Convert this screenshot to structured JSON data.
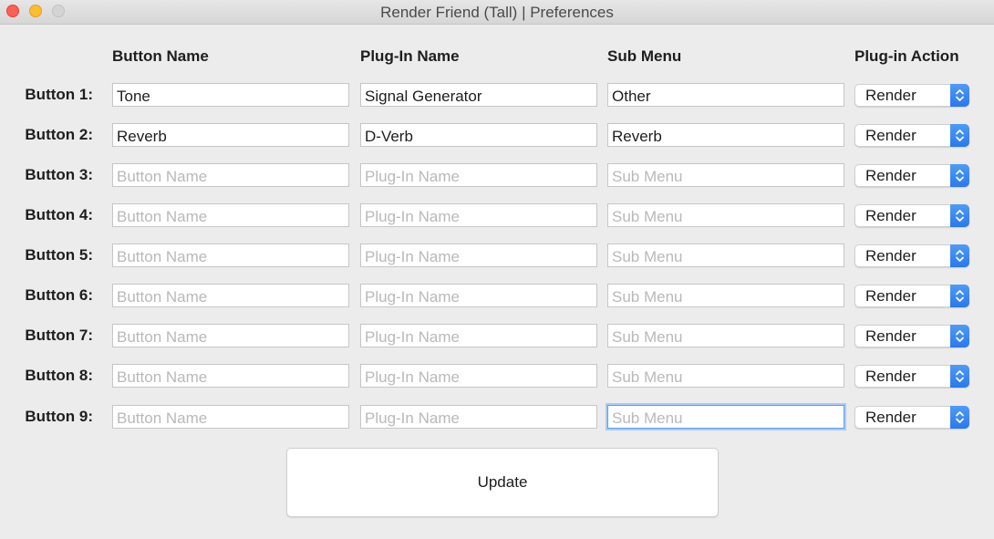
{
  "window": {
    "title": "Render Friend (Tall) | Preferences"
  },
  "columns": {
    "button_name": "Button Name",
    "plugin_name": "Plug-In Name",
    "sub_menu": "Sub Menu",
    "plugin_action": "Plug-in Action"
  },
  "placeholders": {
    "button_name": "Button Name",
    "plugin_name": "Plug-In Name",
    "sub_menu": "Sub Menu"
  },
  "rows": [
    {
      "label": "Button 1:",
      "button_name": "Tone",
      "plugin_name": "Signal Generator",
      "sub_menu": "Other",
      "action": "Render"
    },
    {
      "label": "Button 2:",
      "button_name": "Reverb",
      "plugin_name": "D-Verb",
      "sub_menu": "Reverb",
      "action": "Render"
    },
    {
      "label": "Button 3:",
      "button_name": "",
      "plugin_name": "",
      "sub_menu": "",
      "action": "Render"
    },
    {
      "label": "Button 4:",
      "button_name": "",
      "plugin_name": "",
      "sub_menu": "",
      "action": "Render"
    },
    {
      "label": "Button 5:",
      "button_name": "",
      "plugin_name": "",
      "sub_menu": "",
      "action": "Render"
    },
    {
      "label": "Button 6:",
      "button_name": "",
      "plugin_name": "",
      "sub_menu": "",
      "action": "Render"
    },
    {
      "label": "Button 7:",
      "button_name": "",
      "plugin_name": "",
      "sub_menu": "",
      "action": "Render"
    },
    {
      "label": "Button 8:",
      "button_name": "",
      "plugin_name": "",
      "sub_menu": "",
      "action": "Render"
    },
    {
      "label": "Button 9:",
      "button_name": "",
      "plugin_name": "",
      "sub_menu": "",
      "action": "Render"
    }
  ],
  "update_label": "Update",
  "colors": {
    "accent": "#2f7ff0",
    "close": "#fe5f57",
    "minimize": "#febc2e",
    "zoom_disabled": "#d4d4d4"
  },
  "icons": {
    "close": "close-icon",
    "minimize": "minimize-icon",
    "zoom": "zoom-icon",
    "select_arrows": "chevron-up-down-icon"
  }
}
